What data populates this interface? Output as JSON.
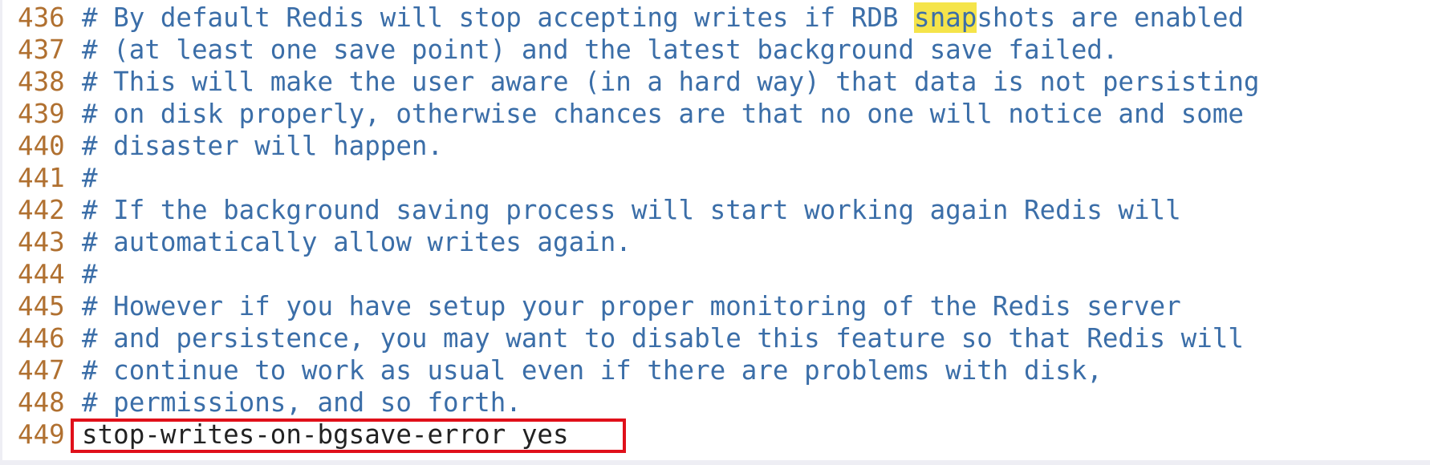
{
  "lines": [
    {
      "num": "436",
      "pre": "# By default Redis will stop accepting writes if RDB ",
      "hl": "snap",
      "post": "shots are enabled"
    },
    {
      "num": "437",
      "text": "# (at least one save point) and the latest background save failed."
    },
    {
      "num": "438",
      "text": "# This will make the user aware (in a hard way) that data is not persisting"
    },
    {
      "num": "439",
      "text": "# on disk properly, otherwise chances are that no one will notice and some"
    },
    {
      "num": "440",
      "text": "# disaster will happen."
    },
    {
      "num": "441",
      "text": "#"
    },
    {
      "num": "442",
      "text": "# If the background saving process will start working again Redis will"
    },
    {
      "num": "443",
      "text": "# automatically allow writes again."
    },
    {
      "num": "444",
      "text": "#"
    },
    {
      "num": "445",
      "text": "# However if you have setup your proper monitoring of the Redis server"
    },
    {
      "num": "446",
      "text": "# and persistence, you may want to disable this feature so that Redis will"
    },
    {
      "num": "447",
      "text": "# continue to work as usual even if there are problems with disk,"
    },
    {
      "num": "448",
      "text": "# permissions, and so forth."
    },
    {
      "num": "449",
      "text": "stop-writes-on-bgsave-error yes"
    }
  ],
  "colors": {
    "line_number": "#b07030",
    "comment": "#3b6ea8",
    "code": "#222222",
    "search_highlight": "#f5e44a",
    "annotation_box": "#e0101a"
  }
}
